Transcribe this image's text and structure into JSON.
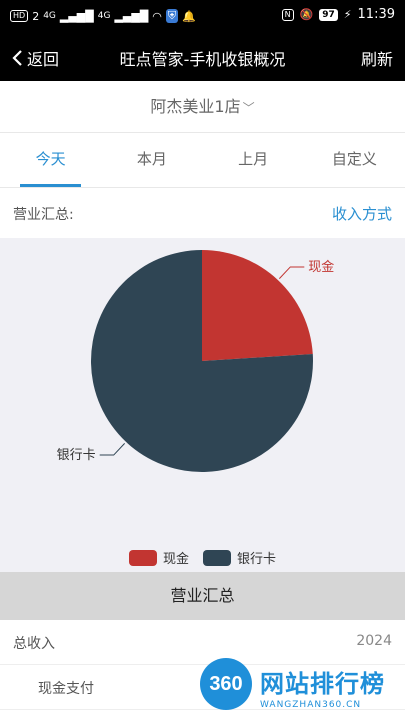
{
  "status_bar": {
    "left": [
      "HD",
      "2",
      "4G",
      "ıll",
      "4G",
      "ıll",
      "wifi",
      "vpn",
      "bell"
    ],
    "nfc": "N",
    "mute": "🔕",
    "battery": "97",
    "time": "11:39"
  },
  "nav": {
    "back_label": "返回",
    "title": "旺点管家-手机收银概况",
    "refresh_label": "刷新"
  },
  "store": {
    "name": "阿杰美业1店"
  },
  "tabs": [
    {
      "label": "今天",
      "active": true
    },
    {
      "label": "本月",
      "active": false
    },
    {
      "label": "上月",
      "active": false
    },
    {
      "label": "自定义",
      "active": false
    }
  ],
  "summary": {
    "label": "营业汇总:",
    "link": "收入方式"
  },
  "chart_data": {
    "type": "pie",
    "categories": [
      "现金",
      "银行卡"
    ],
    "values": [
      24,
      76
    ],
    "colors": [
      "#c23531",
      "#2f4554"
    ],
    "legend_position": "bottom-center"
  },
  "section": {
    "title": "营业汇总"
  },
  "rows": [
    {
      "label": "总收入",
      "value": "2024"
    },
    {
      "label": "现金支付",
      "value": ""
    }
  ],
  "watermark": {
    "badge": "360",
    "title": "网站排行榜",
    "url": "WANGZHAN360.CN"
  }
}
